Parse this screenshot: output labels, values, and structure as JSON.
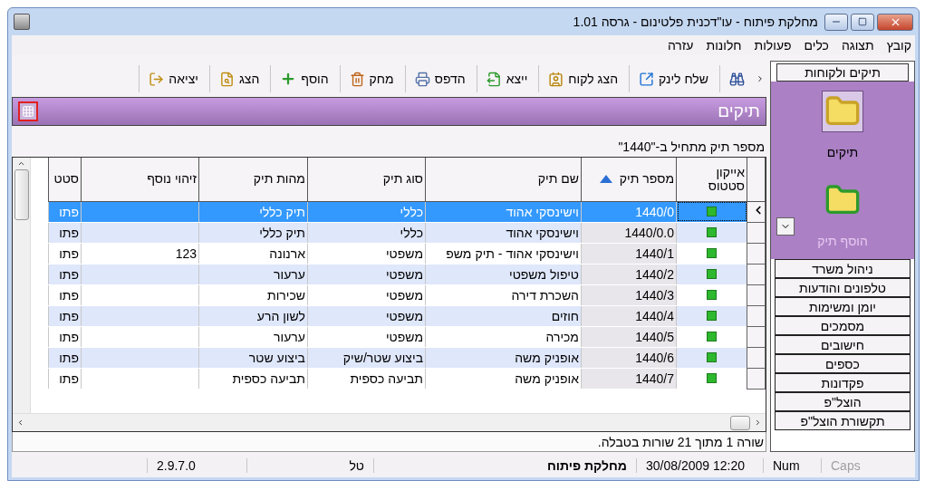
{
  "window": {
    "title": "מחלקת פיתוח - עו\"דכנית פלטינום - גרסה 1.01"
  },
  "menu": [
    "קובץ",
    "תצוגה",
    "כלים",
    "פעולות",
    "חלונות",
    "עזרה"
  ],
  "toolbar": [
    {
      "label": "שלח לינק",
      "kind": "link"
    },
    {
      "label": "הצג לקוח",
      "kind": "client"
    },
    {
      "label": "ייצא",
      "kind": "export"
    },
    {
      "label": "הדפס",
      "kind": "print"
    },
    {
      "label": "מחק",
      "kind": "delete"
    },
    {
      "label": "הוסף",
      "kind": "add"
    },
    {
      "label": "הצג",
      "kind": "view"
    },
    {
      "label": "יציאה",
      "kind": "exit"
    }
  ],
  "panel": {
    "title": "תיקים",
    "filter": "מספר תיק מתחיל ב-\"1440\""
  },
  "table": {
    "columns": [
      {
        "label": "אייקון סטטוס",
        "sorted": false
      },
      {
        "label": "מספר תיק",
        "sorted": true
      },
      {
        "label": "שם תיק",
        "sorted": false
      },
      {
        "label": "סוג תיק",
        "sorted": false
      },
      {
        "label": "מהות תיק",
        "sorted": false
      },
      {
        "label": "זיהוי נוסף",
        "sorted": false
      },
      {
        "label": "סטט",
        "sorted": false
      }
    ],
    "rows": [
      {
        "selected": true,
        "color": "#2db82d",
        "cells": [
          "",
          "1440/0",
          "וישינסקי  אהוד",
          "כללי",
          "תיק כללי",
          "",
          "פתו"
        ]
      },
      {
        "selected": false,
        "color": "#2db82d",
        "cells": [
          "",
          "1440/0.0",
          "וישינסקי  אהוד",
          "כללי",
          "תיק כללי",
          "",
          "פתו"
        ]
      },
      {
        "selected": false,
        "color": "#2db82d",
        "cells": [
          "",
          "1440/1",
          "וישינסקי אהוד - תיק משפ",
          "משפטי",
          "ארנונה",
          "123",
          "פתו"
        ]
      },
      {
        "selected": false,
        "color": "#2db82d",
        "cells": [
          "",
          "1440/2",
          "טיפול משפטי",
          "משפטי",
          "ערעור",
          "",
          "פתו"
        ]
      },
      {
        "selected": false,
        "color": "#2db82d",
        "cells": [
          "",
          "1440/3",
          "השכרת דירה",
          "משפטי",
          "שכירות",
          "",
          "פתו"
        ]
      },
      {
        "selected": false,
        "color": "#2db82d",
        "cells": [
          "",
          "1440/4",
          "חוזים",
          "משפטי",
          "לשון הרע",
          "",
          "פתו"
        ]
      },
      {
        "selected": false,
        "color": "#2db82d",
        "cells": [
          "",
          "1440/5",
          "מכירה",
          "משפטי",
          "ערעור",
          "",
          "פתו"
        ]
      },
      {
        "selected": false,
        "color": "#2db82d",
        "cells": [
          "",
          "1440/6",
          "אופניק משה",
          "ביצוע שטר/שיק",
          "ביצוע שטר",
          "",
          "פתו"
        ]
      },
      {
        "selected": false,
        "color": "#2db82d",
        "cells": [
          "",
          "1440/7",
          "אופניק משה",
          "תביעה כספית",
          "תביעה כספית",
          "",
          "פתו"
        ]
      }
    ]
  },
  "row_status": "שורה 1 מתוך 21 שורות בטבלה.",
  "sidebar": {
    "header": "תיקים ולקוחות",
    "tiles": [
      {
        "label": "תיקים",
        "kind": "folder",
        "selected": true
      },
      {
        "label": "הוסף תיק",
        "kind": "add-folder",
        "selected": false
      }
    ],
    "items": [
      "ניהול משרד",
      "טלפונים והודעות",
      "יומן ומשימות",
      "מסמכים",
      "חישובים",
      "כספים",
      "פקדונות",
      "הוצל\"פ",
      "תקשורת הוצל\"פ"
    ]
  },
  "status_bar": {
    "version": "2.9.7.0",
    "user": "טל",
    "department": "מחלקת פיתוח",
    "datetime": "30/08/2009 12:20",
    "keys": [
      {
        "label": "Caps",
        "on": false
      },
      {
        "label": "Num",
        "on": true
      }
    ]
  }
}
